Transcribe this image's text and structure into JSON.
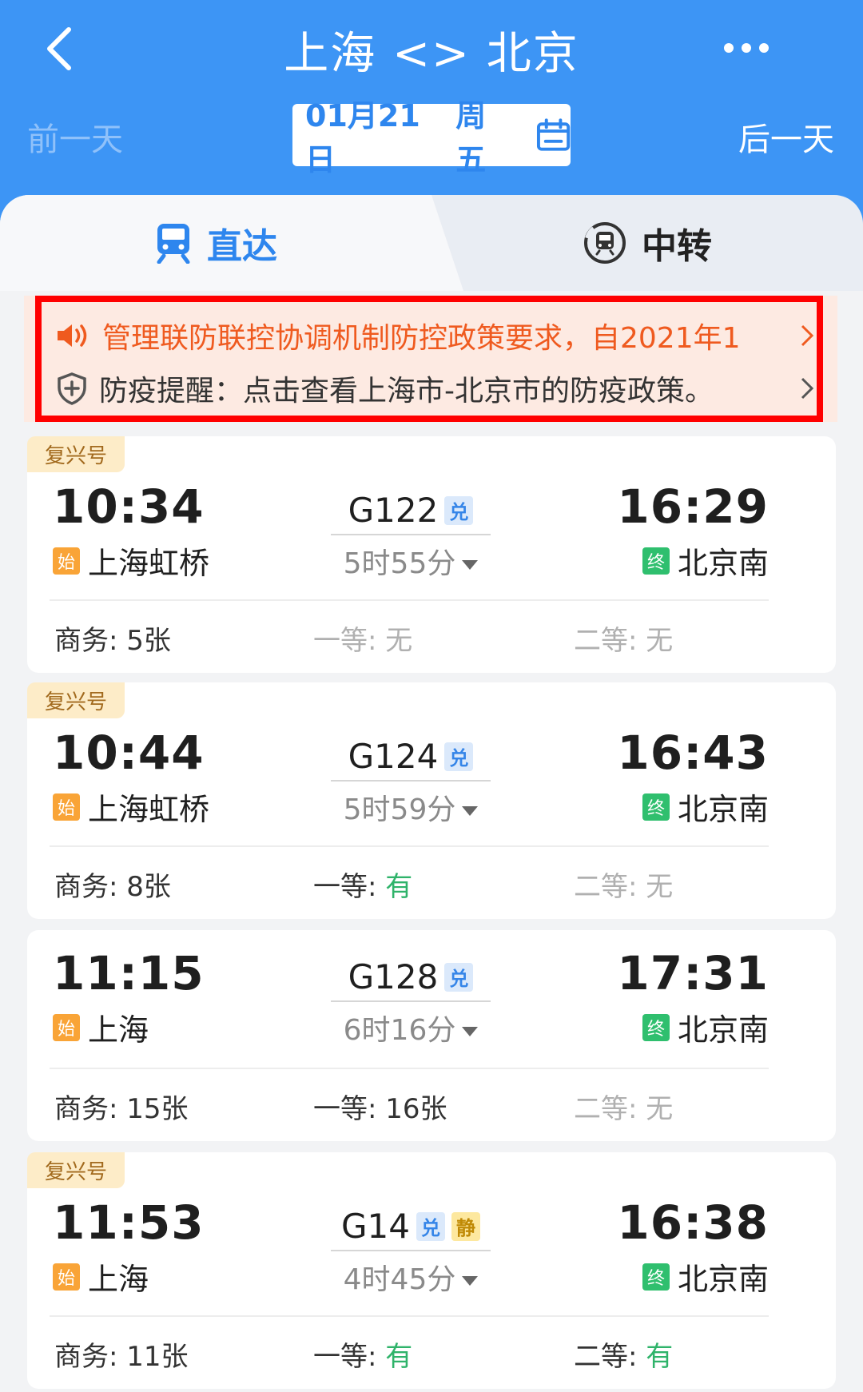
{
  "header": {
    "title": "上海 <> 北京",
    "prev_day": "前一天",
    "next_day": "后一天",
    "date": "01月21日",
    "weekday": "周五",
    "bg_color": "#3d95f5"
  },
  "tabs": [
    {
      "label": "直达",
      "icon": "train-icon",
      "active": true
    },
    {
      "label": "中转",
      "icon": "transfer-train-icon",
      "active": false
    }
  ],
  "notice": {
    "line1": "管理联防联控协调机制防控政策要求，自2021年1",
    "line2": "防疫提醒：点击查看上海市-北京市的防疫政策。"
  },
  "trains": [
    {
      "badge": "复兴号",
      "dep_time": "10:34",
      "dep_tag": "始",
      "dep_station": "上海虹桥",
      "train_no": "G122",
      "tags": [
        "兑"
      ],
      "duration": "5时55分",
      "arr_time": "16:29",
      "arr_tag": "终",
      "arr_station": "北京南",
      "seats": [
        {
          "label": "商务: ",
          "value": "5张"
        },
        {
          "label": "一等: ",
          "value": "无"
        },
        {
          "label": "二等: ",
          "value": "无"
        }
      ]
    },
    {
      "badge": "复兴号",
      "dep_time": "10:44",
      "dep_tag": "始",
      "dep_station": "上海虹桥",
      "train_no": "G124",
      "tags": [
        "兑"
      ],
      "duration": "5时59分",
      "arr_time": "16:43",
      "arr_tag": "终",
      "arr_station": "北京南",
      "seats": [
        {
          "label": "商务: ",
          "value": "8张"
        },
        {
          "label": "一等: ",
          "value": "有"
        },
        {
          "label": "二等: ",
          "value": "无"
        }
      ]
    },
    {
      "badge": "",
      "dep_time": "11:15",
      "dep_tag": "始",
      "dep_station": "上海",
      "train_no": "G128",
      "tags": [
        "兑"
      ],
      "duration": "6时16分",
      "arr_time": "17:31",
      "arr_tag": "终",
      "arr_station": "北京南",
      "seats": [
        {
          "label": "商务: ",
          "value": "15张"
        },
        {
          "label": "一等: ",
          "value": "16张"
        },
        {
          "label": "二等: ",
          "value": "无"
        }
      ]
    },
    {
      "badge": "复兴号",
      "dep_time": "11:53",
      "dep_tag": "始",
      "dep_station": "上海",
      "train_no": "G14",
      "tags": [
        "兑",
        "静"
      ],
      "duration": "4时45分",
      "arr_time": "16:38",
      "arr_tag": "终",
      "arr_station": "北京南",
      "seats": [
        {
          "label": "商务: ",
          "value": "11张"
        },
        {
          "label": "一等: ",
          "value": "有"
        },
        {
          "label": "二等: ",
          "value": "有"
        }
      ]
    }
  ]
}
